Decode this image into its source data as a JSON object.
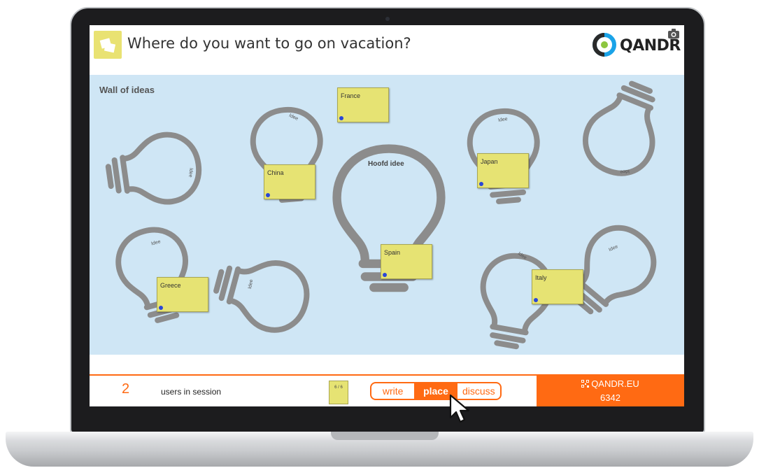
{
  "header": {
    "title": "Where do you want to go on vacation?",
    "logo_text": "QANDR",
    "icon": "sticky-notes-icon",
    "camera_icon": "camera-icon"
  },
  "wall": {
    "title": "Wall of ideas",
    "main_idea": "Hoofd idee",
    "bulb_label": "Idee",
    "notes": [
      {
        "text": "France"
      },
      {
        "text": "China"
      },
      {
        "text": "Japan"
      },
      {
        "text": "Spain"
      },
      {
        "text": "Greece"
      },
      {
        "text": "Italy"
      }
    ]
  },
  "footer": {
    "user_count": "2",
    "users_label": "users in session",
    "page_indicator": "6 / 6",
    "modes": [
      "write",
      "place",
      "discuss"
    ],
    "active_mode": "place",
    "qr_url": "QANDR.EU",
    "session_code": "6342",
    "qr_icon": "qr-code-icon"
  },
  "colors": {
    "accent": "#ff6a13",
    "wall_background": "#cfe6f5",
    "note": "#e6e373",
    "bulb_outline": "#8c8c8c",
    "note_dot": "#2a47d6"
  }
}
